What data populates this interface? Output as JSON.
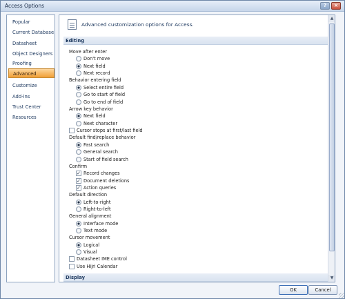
{
  "window": {
    "title": "Access Options",
    "help_glyph": "?",
    "close_glyph": "×"
  },
  "sidebar": {
    "items": [
      {
        "label": "Popular"
      },
      {
        "label": "Current Database"
      },
      {
        "label": "Datasheet"
      },
      {
        "label": "Object Designers"
      },
      {
        "label": "Proofing"
      },
      {
        "label": "Advanced",
        "active": true
      },
      {
        "label": "Customize"
      },
      {
        "label": "Add-ins"
      },
      {
        "label": "Trust Center"
      },
      {
        "label": "Resources"
      }
    ]
  },
  "content": {
    "header": "Advanced customization options for Access.",
    "sections": {
      "editing": "Editing",
      "display": "Display"
    },
    "groups": {
      "move_after_enter": {
        "label": "Move after enter",
        "options": [
          "Don't move",
          "Next field",
          "Next record"
        ],
        "selected": "Next field"
      },
      "behavior_entering_field": {
        "label": "Behavior entering field",
        "options": [
          "Select entire field",
          "Go to start of field",
          "Go to end of field"
        ],
        "selected": "Select entire field"
      },
      "arrow_key_behavior": {
        "label": "Arrow key behavior",
        "options": [
          "Next field",
          "Next character"
        ],
        "selected": "Next field"
      },
      "cursor_stops": {
        "label": "Cursor stops at first/last field",
        "checked": false
      },
      "find_replace": {
        "label": "Default find/replace behavior",
        "options": [
          "Fast search",
          "General search",
          "Start of field search"
        ],
        "selected": "Fast search"
      },
      "confirm": {
        "label": "Confirm",
        "items": [
          {
            "label": "Record changes",
            "checked": true
          },
          {
            "label": "Document deletions",
            "checked": true
          },
          {
            "label": "Action queries",
            "checked": true
          }
        ]
      },
      "default_direction": {
        "label": "Default direction",
        "options": [
          "Left-to-right",
          "Right-to-left"
        ],
        "selected": "Left-to-right"
      },
      "general_alignment": {
        "label": "General alignment",
        "options": [
          "Interface mode",
          "Text mode"
        ],
        "selected": "Interface mode"
      },
      "cursor_movement": {
        "label": "Cursor movement",
        "options": [
          "Logical",
          "Visual"
        ],
        "selected": "Logical"
      },
      "datasheet_ime": {
        "label": "Datasheet IME control",
        "checked": false
      },
      "hijri": {
        "label": "Use Hijri Calendar",
        "checked": false
      }
    }
  },
  "scroll": {
    "up_glyph": "▲",
    "down_glyph": "▼"
  },
  "buttons": {
    "ok": "OK",
    "cancel": "Cancel"
  }
}
